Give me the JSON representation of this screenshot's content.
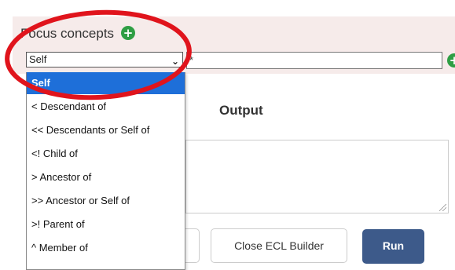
{
  "focus": {
    "label": "Focus concepts",
    "selected_operator": "Self",
    "term_value": "*"
  },
  "dropdown": {
    "options": [
      "Self",
      "< Descendant of",
      "<< Descendants or Self of",
      "<! Child of",
      "> Ancestor of",
      ">> Ancestor or Self of",
      ">! Parent of",
      "^ Member of"
    ]
  },
  "output": {
    "heading": "Output"
  },
  "buttons": {
    "close_label": "Close ECL Builder",
    "run_label": "Run"
  },
  "colors": {
    "panel_bg": "#f6ebea",
    "selected_option": "#1e6fd9",
    "run_button": "#3d5a8a",
    "add_icon": "#2f9e44",
    "annotation_circle": "#e0141c"
  },
  "icons": [
    "add-icon",
    "chevron-down-icon",
    "resize-grip-icon"
  ]
}
